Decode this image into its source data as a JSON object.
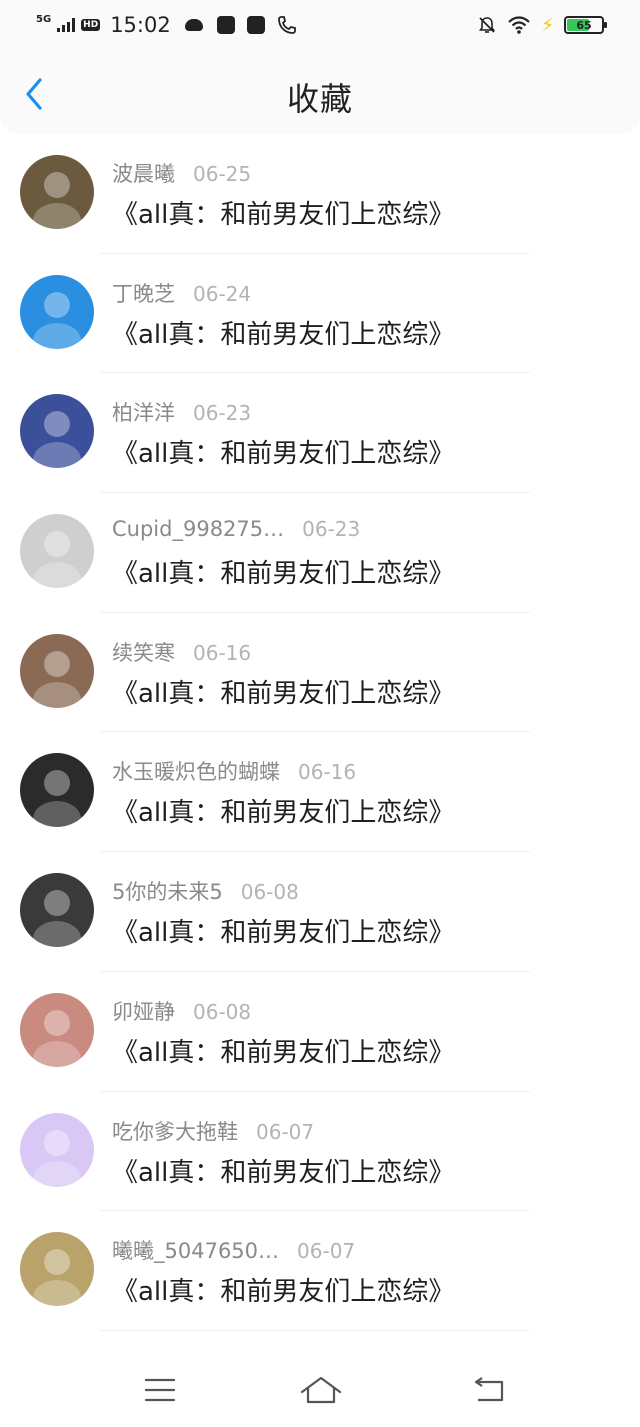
{
  "status_bar": {
    "network": "5G",
    "hd": "HD",
    "time": "15:02",
    "battery": "65",
    "battery_level": 0.65,
    "icons": [
      "signal-icon",
      "cloud-icon",
      "vivo-app-icon",
      "app-icon",
      "call-icon",
      "mute-bell-icon",
      "wifi-icon",
      "charging-bolt-icon",
      "battery-icon"
    ]
  },
  "header": {
    "back_icon": "chevron-left-icon",
    "title": "收藏"
  },
  "favorites": [
    {
      "author": "波晨曦",
      "date": "06-25",
      "title": "《all真：和前男友们上恋综》",
      "avatar_color": "#6b5a3e"
    },
    {
      "author": "丁晚芝",
      "date": "06-24",
      "title": "《all真：和前男友们上恋综》",
      "avatar_color": "#2a8fe0"
    },
    {
      "author": "柏洋洋",
      "date": "06-23",
      "title": "《all真：和前男友们上恋综》",
      "avatar_color": "#3b4f9a"
    },
    {
      "author": "Cupid_998275…",
      "date": "06-23",
      "title": "《all真：和前男友们上恋综》",
      "avatar_color": "#cfcfcf"
    },
    {
      "author": "续笑寒",
      "date": "06-16",
      "title": "《all真：和前男友们上恋综》",
      "avatar_color": "#8a6a55"
    },
    {
      "author": "水玉暖炽色的蝴蝶",
      "date": "06-16",
      "title": "《all真：和前男友们上恋综》",
      "avatar_color": "#2b2b2b"
    },
    {
      "author": "5你的未来5",
      "date": "06-08",
      "title": "《all真：和前男友们上恋综》",
      "avatar_color": "#3a3a3a"
    },
    {
      "author": "卯娅静",
      "date": "06-08",
      "title": "《all真：和前男友们上恋综》",
      "avatar_color": "#c98a80"
    },
    {
      "author": "吃你爹大拖鞋",
      "date": "06-07",
      "title": "《all真：和前男友们上恋综》",
      "avatar_color": "#d9c8f5"
    },
    {
      "author": "曦曦_5047650…",
      "date": "06-07",
      "title": "《all真：和前男友们上恋综》",
      "avatar_color": "#b9a36a"
    }
  ],
  "nav_bar": {
    "icons": [
      "menu-icon",
      "home-icon",
      "back-icon"
    ]
  }
}
